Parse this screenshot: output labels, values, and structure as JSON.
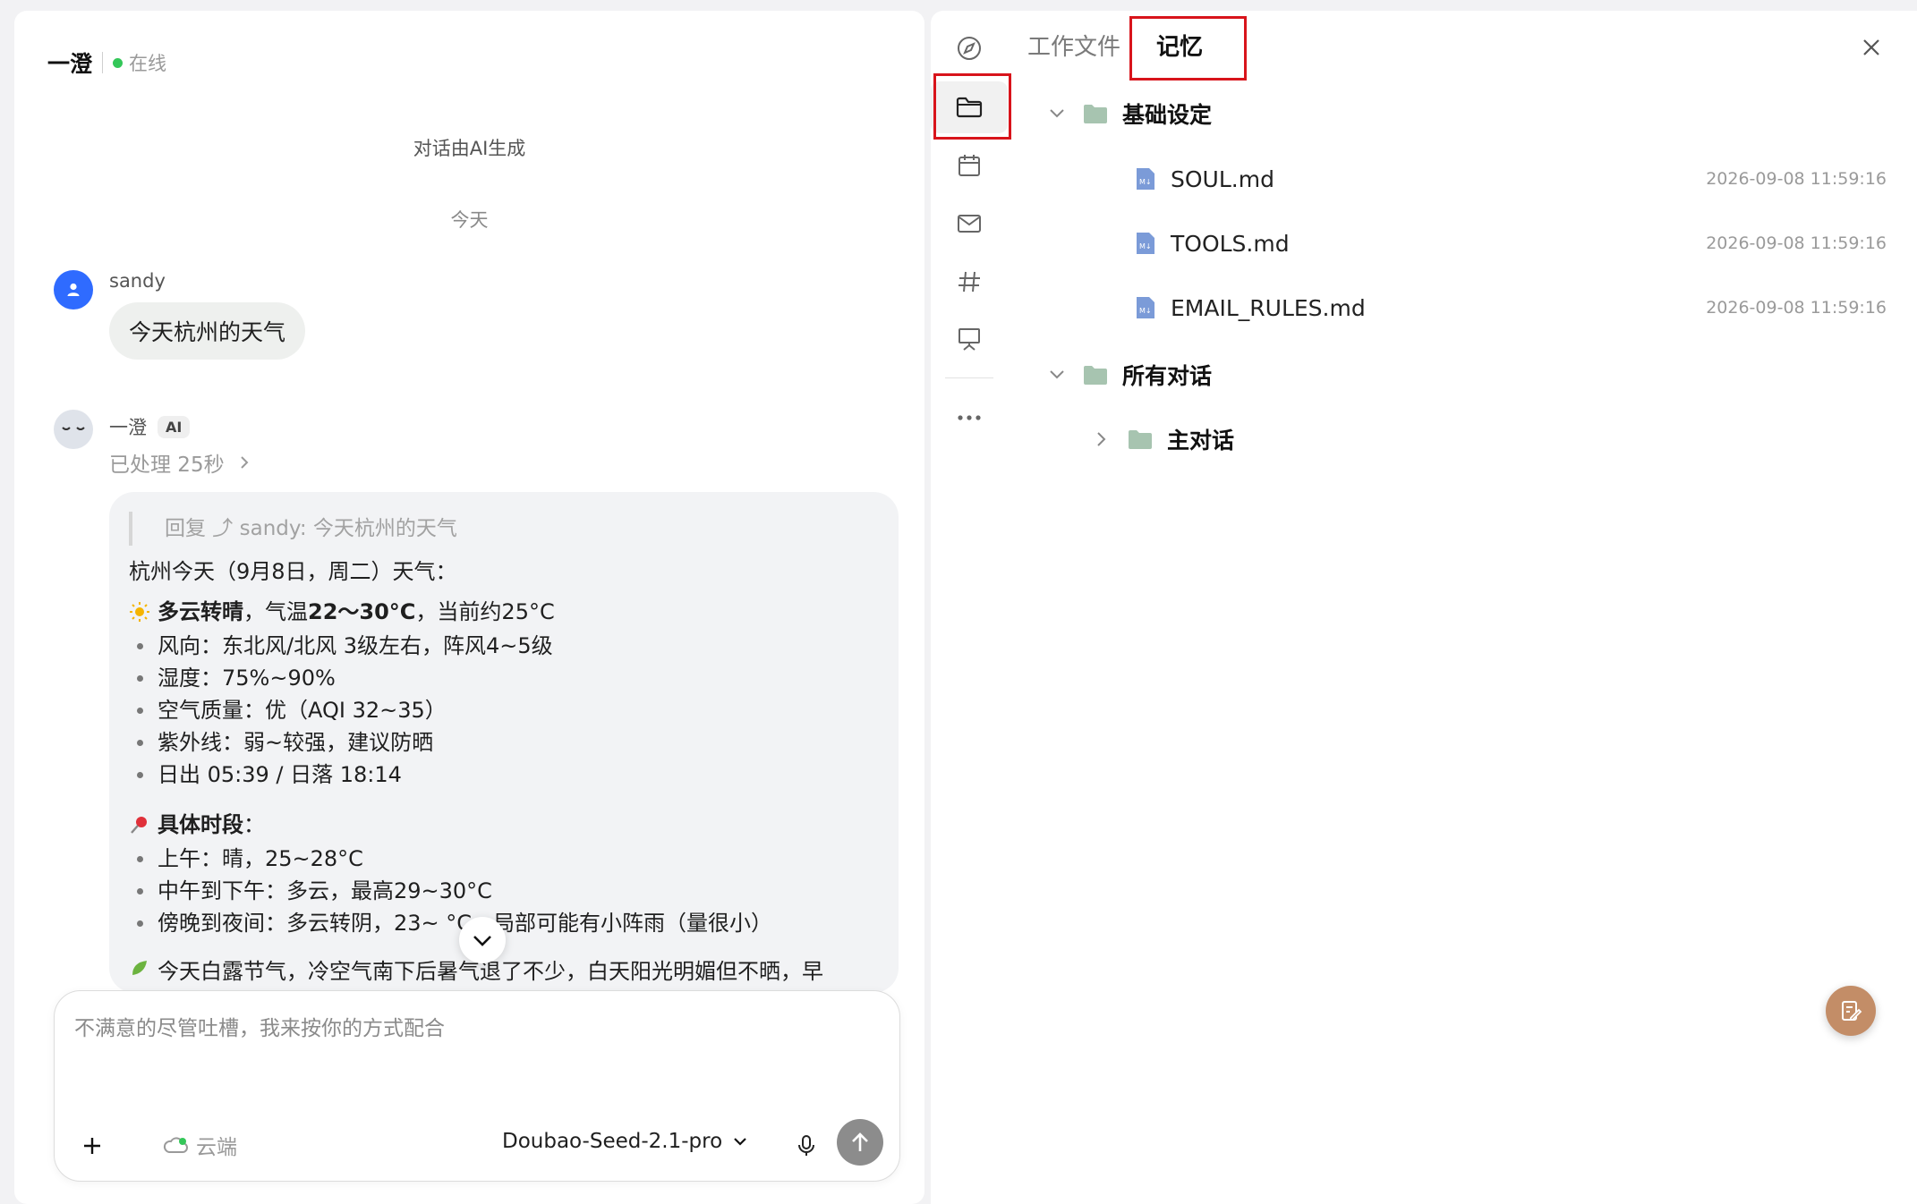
{
  "chat": {
    "agent_name": "一澄",
    "status": "在线",
    "ai_notice": "对话由AI生成",
    "date_divider": "今天",
    "user": {
      "name": "sandy",
      "message": "今天杭州的天气"
    },
    "ai": {
      "name": "一澄",
      "badge": "AI",
      "processed": "已处理 25秒",
      "quote": "回复 ⤴ sandy:  今天杭州的天气",
      "intro": "杭州今天（9月8日，周二）天气：",
      "summary_a": "多云转晴",
      "summary_b": "，气温 ",
      "summary_c": "22～30°C",
      "summary_d": "，当前约25°C",
      "bullets": [
        "风向：东北风/北风 3级左右，阵风4~5级",
        "湿度：75%~90%",
        "空气质量：优（AQI 32~35）",
        "紫外线：弱~较强，建议防晒",
        "日出 05:39 / 日落 18:14"
      ],
      "section_title": "具体时段",
      "section_colon": "：",
      "periods": [
        "上午：晴，25~28°C",
        "中午到下午：多云，最高29~30°C",
        "傍晚到夜间：多云转阴，23~   °C，局部可能有小阵雨（量很小）"
      ],
      "cut_line": "今天白露节气，冷空气南下后暑气退了不少，白天阳光明媚但不晒，早"
    },
    "composer": {
      "placeholder": "不满意的尽管吐槽，我来按你的方式配合",
      "cloud_label": "云端",
      "model": "Doubao-Seed-2.1-pro"
    }
  },
  "side_panel": {
    "tabs": [
      {
        "label": "工作文件",
        "active": false
      },
      {
        "label": "记忆",
        "active": true
      }
    ],
    "rail_icons": [
      "compass-icon",
      "folder-icon",
      "calendar-icon",
      "mail-icon",
      "hashtag-icon",
      "presentation-icon",
      "more-icon"
    ],
    "tree": {
      "folder1": {
        "label": "基础设定",
        "files": [
          {
            "name": "SOUL.md",
            "time": "2026-09-08 11:59:16"
          },
          {
            "name": "TOOLS.md",
            "time": "2026-09-08 11:59:16"
          },
          {
            "name": "EMAIL_RULES.md",
            "time": "2026-09-08 11:59:16"
          }
        ]
      },
      "folder2": {
        "label": "所有对话",
        "children": [
          {
            "label": "主对话"
          }
        ]
      }
    }
  },
  "colors": {
    "highlight": "#d8141b",
    "online": "#34c759",
    "user_avatar": "#2f6bff",
    "fab": "#c38d67",
    "folder": "#a7c4b0",
    "md_file": "#7b9bd8"
  }
}
